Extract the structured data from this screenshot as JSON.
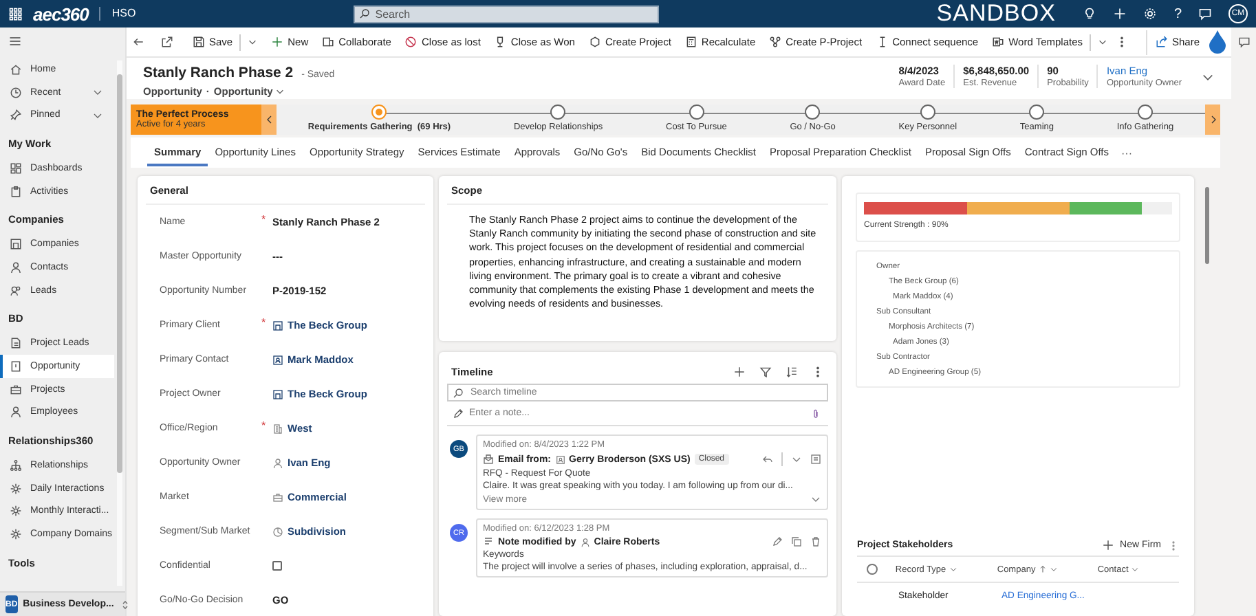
{
  "top_bar": {
    "logo": "aec360",
    "org": "HSO",
    "search": {
      "placeholder": "Search"
    },
    "environment": "SANDBOX",
    "help": "?",
    "user_initials": "CM"
  },
  "sidebar": {
    "sections": [
      {
        "items": [
          {
            "label": "Home",
            "selected": false,
            "expandable": false
          },
          {
            "label": "Recent",
            "selected": false,
            "expandable": true
          },
          {
            "label": "Pinned",
            "selected": false,
            "expandable": true
          }
        ]
      },
      {
        "heading": "My Work",
        "items": [
          {
            "label": "Dashboards",
            "selected": false,
            "expandable": false
          },
          {
            "label": "Activities",
            "selected": false,
            "expandable": false
          }
        ]
      },
      {
        "heading": "Companies",
        "items": [
          {
            "label": "Companies",
            "selected": false,
            "expandable": false
          },
          {
            "label": "Contacts",
            "selected": false,
            "expandable": false
          },
          {
            "label": "Leads",
            "selected": false,
            "expandable": false
          }
        ]
      },
      {
        "heading": "BD",
        "items": [
          {
            "label": "Project Leads",
            "selected": false,
            "expandable": false
          },
          {
            "label": "Opportunity",
            "selected": true,
            "expandable": false
          },
          {
            "label": "Projects",
            "selected": false,
            "expandable": false
          },
          {
            "label": "Employees",
            "selected": false,
            "expandable": false
          }
        ]
      },
      {
        "heading": "Relationships360",
        "items": [
          {
            "label": "Relationships",
            "selected": false,
            "expandable": false
          },
          {
            "label": "Daily Interactions",
            "selected": false,
            "expandable": false
          },
          {
            "label": "Monthly Interacti...",
            "selected": false,
            "expandable": false
          },
          {
            "label": "Company Domains",
            "selected": false,
            "expandable": false
          }
        ]
      },
      {
        "heading": "Tools"
      }
    ],
    "area": {
      "badge": "BD",
      "label": "Business Develop..."
    }
  },
  "command_bar": [
    {
      "label": "Save",
      "has_menu": true
    },
    {
      "label": "New",
      "has_menu": false
    },
    {
      "label": "Collaborate",
      "has_menu": false
    },
    {
      "label": "Close as lost",
      "has_menu": false
    },
    {
      "label": "Close as Won",
      "has_menu": false
    },
    {
      "label": "Create Project",
      "has_menu": false
    },
    {
      "label": "Recalculate",
      "has_menu": false
    },
    {
      "label": "Create P-Project",
      "has_menu": false
    },
    {
      "label": "Connect sequence",
      "has_menu": false
    },
    {
      "label": "Word Templates",
      "has_menu": true
    }
  ],
  "share": "Share",
  "record": {
    "title": "Stanly Ranch Phase 2",
    "save_state": "- Saved",
    "entity": "Opportunity",
    "separator": "·",
    "form": "Opportunity",
    "fields": [
      {
        "value": "8/4/2023",
        "label": "Award Date",
        "kind": "text"
      },
      {
        "value": "$6,848,650.00",
        "label": "Est. Revenue",
        "kind": "text"
      },
      {
        "value": "90",
        "label": "Probability",
        "kind": "text"
      },
      {
        "value": "Ivan Eng",
        "label": "Opportunity Owner",
        "kind": "link"
      }
    ]
  },
  "process": {
    "name": "The Perfect Process",
    "age": "Active for 4 years",
    "stages": [
      {
        "label": "Requirements Gathering",
        "duration": "(69 Hrs)",
        "selected": true
      },
      {
        "label": "Develop Relationships",
        "selected": false
      },
      {
        "label": "Cost To Pursue",
        "selected": false
      },
      {
        "label": "Go / No-Go",
        "selected": false
      },
      {
        "label": "Key Personnel",
        "selected": false
      },
      {
        "label": "Teaming",
        "selected": false
      },
      {
        "label": "Info Gathering",
        "selected": false
      }
    ]
  },
  "tabs": [
    {
      "label": "Summary",
      "selected": true
    },
    {
      "label": "Opportunity Lines",
      "selected": false
    },
    {
      "label": "Opportunity Strategy",
      "selected": false
    },
    {
      "label": "Services Estimate",
      "selected": false
    },
    {
      "label": "Approvals",
      "selected": false
    },
    {
      "label": "Go/No Go's",
      "selected": false
    },
    {
      "label": "Bid Documents Checklist",
      "selected": false
    },
    {
      "label": "Proposal Preparation Checklist",
      "selected": false
    },
    {
      "label": "Proposal Sign Offs",
      "selected": false
    },
    {
      "label": "Contract Sign Offs",
      "selected": false
    }
  ],
  "tabs_more": "···",
  "general": {
    "title": "General",
    "required_mark": "*",
    "fields": [
      {
        "label": "Name",
        "required": true,
        "kind": "text",
        "value": "Stanly Ranch Phase 2"
      },
      {
        "label": "Master Opportunity",
        "required": false,
        "kind": "text",
        "value": "---"
      },
      {
        "label": "Opportunity Number",
        "required": false,
        "kind": "text",
        "value": "P-2019-152"
      },
      {
        "label": "Primary Client",
        "required": true,
        "kind": "account",
        "value": "The Beck Group"
      },
      {
        "label": "Primary Contact",
        "required": false,
        "kind": "contact",
        "value": "Mark Maddox"
      },
      {
        "label": "Project Owner",
        "required": false,
        "kind": "account",
        "value": "The Beck Group"
      },
      {
        "label": "Office/Region",
        "required": true,
        "kind": "office",
        "value": "West"
      },
      {
        "label": "Opportunity Owner",
        "required": false,
        "kind": "user",
        "value": "Ivan Eng"
      },
      {
        "label": "Market",
        "required": false,
        "kind": "market",
        "value": "Commercial"
      },
      {
        "label": "Segment/Sub Market",
        "required": false,
        "kind": "segment",
        "value": "Subdivision"
      },
      {
        "label": "Confidential",
        "required": false,
        "kind": "checkbox",
        "checked": false
      },
      {
        "label": "Go/No-Go Decision",
        "required": false,
        "kind": "text",
        "value": "GO"
      }
    ]
  },
  "scope": {
    "title": "Scope",
    "text": "The Stanly Ranch Phase 2 project aims to continue the development of the Stanly Ranch community by initiating the second phase of construction and site work. This project focuses on the development of residential and commercial properties, enhancing infrastructure, and creating a sustainable and modern living environment. The primary goal is to create a vibrant and cohesive community that complements the existing Phase 1 development and meets the evolving needs of residents and businesses."
  },
  "timeline": {
    "title": "Timeline",
    "search": {
      "placeholder": "Search timeline"
    },
    "note": {
      "placeholder": "Enter a note..."
    },
    "entries": [
      {
        "kind": "email",
        "initials": "GB",
        "color": "#0b4a7e",
        "modified": "Modified on: 8/4/2023 1:22 PM",
        "action": "Email from:",
        "person": "Gerry Broderson (SXS US)",
        "badge": "Closed",
        "subject": "RFQ - Request For Quote",
        "body": "Claire.   It was great speaking with you today.  I am following up from our di...",
        "more": "View more"
      },
      {
        "kind": "note",
        "initials": "CR",
        "color": "#4f6bed",
        "modified": "Modified on: 6/12/2023 1:28 PM",
        "action": "Note modified by",
        "person": "Claire Roberts",
        "subject": "Keywords",
        "body": "The project will involve a series of phases, including exploration, appraisal, d..."
      }
    ]
  },
  "strength": {
    "level": 0.9,
    "caption": "Current Strength : 90%"
  },
  "relationships": [
    {
      "label": "Owner",
      "children": [
        {
          "label": "The Beck Group (6)",
          "children": [
            {
              "label": "Mark Maddox (4)"
            }
          ]
        }
      ]
    },
    {
      "label": "Sub Consultant",
      "children": [
        {
          "label": "Morphosis Architects (7)",
          "children": [
            {
              "label": "Adam Jones (3)"
            }
          ]
        }
      ]
    },
    {
      "label": "Sub Contractor",
      "children": [
        {
          "label": "AD Engineering Group (5)"
        }
      ]
    }
  ],
  "stakeholders": {
    "title": "Project Stakeholders",
    "new_button": "New Firm",
    "select_all": {
      "checked": false
    },
    "columns": [
      {
        "label": "Record Type",
        "sorted": false
      },
      {
        "label": "Company",
        "sorted": true
      },
      {
        "label": "Contact",
        "sorted": false
      }
    ],
    "rows": [
      {
        "record_type": "Stakeholder",
        "company": "AD Engineering G..."
      }
    ]
  }
}
